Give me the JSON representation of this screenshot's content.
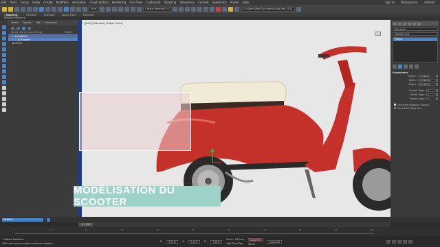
{
  "menu": {
    "items": [
      "Edit",
      "Tools",
      "Group",
      "Views",
      "Create",
      "Modifiers",
      "Animation",
      "Graph Editors",
      "Rendering",
      "Civil View",
      "Customize",
      "Scripting",
      "Interactive",
      "Content",
      "Substance",
      "Arnold",
      "Help"
    ],
    "sign_in": "Sign In",
    "workspaces_label": "Workspaces:",
    "workspace": "Default"
  },
  "toolbar": {
    "view_dropdown": "View",
    "selection_set": "Create Selection Se",
    "project_path": "C:\\Users\\Vitor\\Documents\\3ds Max 2021"
  },
  "ribbon": {
    "tabs": [
      "Modeling",
      "Freeform",
      "Selection",
      "Object Paint",
      "Populate"
    ],
    "active_tab": "Modeling",
    "sub_label": "Polygon Modeling"
  },
  "scene_explorer": {
    "tabs": [
      "Select",
      "Display",
      "Edit",
      "Customize"
    ],
    "column_header": "Name (Sorted Ascending)",
    "column_header2": "Frozen",
    "rows": [
      {
        "label": "0 (default)"
      },
      {
        "label": "Scooter"
      },
      {
        "label": "Plane"
      }
    ]
  },
  "viewport": {
    "label": "[+] [Left] [Standard] [Edged Faces]",
    "caption": "MODÉLISATION DU SCOOTER"
  },
  "command_panel": {
    "object_name": "Plane001",
    "modifier_list": "Modifier List",
    "stack_items": [
      "Plane"
    ],
    "section": "Parameters",
    "params": [
      {
        "label": "Length:",
        "value": "75,363cm"
      },
      {
        "label": "Width:",
        "value": "133,924cm"
      },
      {
        "label": "Height:",
        "value": "90,143cm"
      }
    ],
    "segs": [
      {
        "label": "Length Segs:",
        "value": "1"
      },
      {
        "label": "Width Segs:",
        "value": "1"
      },
      {
        "label": "Height Segs:",
        "value": "1"
      }
    ],
    "checks": [
      "Generate Mapping Coords.",
      "Real-World Map Size"
    ]
  },
  "bottom": {
    "layer": "Default",
    "time_slider": "0 / 100",
    "ticks": [
      "0",
      "10",
      "20",
      "30",
      "40",
      "50",
      "60",
      "70",
      "80",
      "90",
      "100"
    ],
    "status_selected": "1 Object Selected",
    "status_hint": "Click and drag to select and move objects",
    "x_label": "X:",
    "x_value": "0,0cm",
    "y_label": "Y:",
    "y_value": "0,0cm",
    "z_label": "Z:",
    "z_value": "0,0cm",
    "grid": "Grid = 10,0cm",
    "add_time_tag": "Add Time Tag",
    "auto_key": "Auto Key",
    "selected": "Selected",
    "set_key": "Set K."
  },
  "colors": {
    "accent": "#4a84c6",
    "caption_bg": "#9dd2c8",
    "scooter_red": "#c4302a"
  }
}
